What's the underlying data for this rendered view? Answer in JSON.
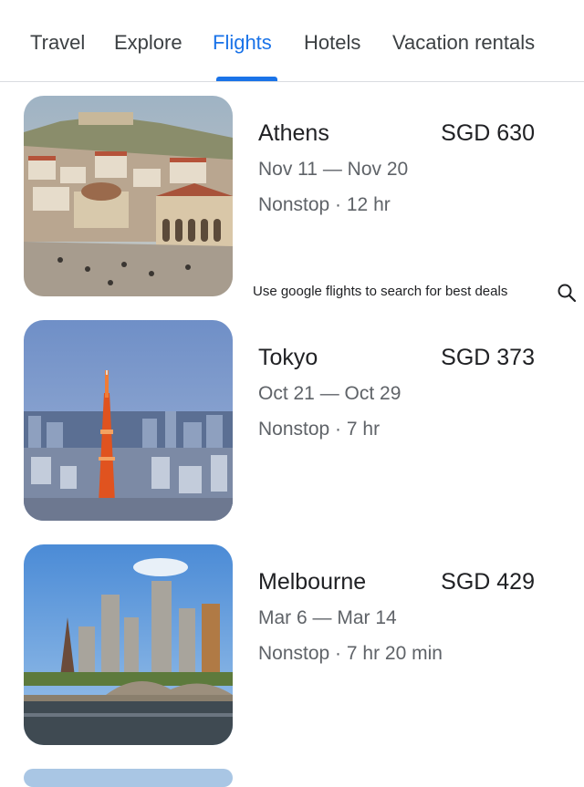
{
  "tabs": [
    {
      "label": "Travel"
    },
    {
      "label": "Explore"
    },
    {
      "label": "Flights"
    },
    {
      "label": "Hotels"
    },
    {
      "label": "Vacation rentals"
    }
  ],
  "active_tab": "Flights",
  "destinations": [
    {
      "city": "Athens",
      "price": "SGD 630",
      "dates": "Nov 11 — Nov 20",
      "stops": "Nonstop · 12 hr"
    },
    {
      "city": "Tokyo",
      "price": "SGD 373",
      "dates": "Oct 21 — Oct 29",
      "stops": "Nonstop · 7 hr"
    },
    {
      "city": "Melbourne",
      "price": "SGD 429",
      "dates": "Mar 6 — Mar 14",
      "stops": "Nonstop · 7 hr 20 min"
    }
  ],
  "sponsored": {
    "text": "Use google flights to search for best deals",
    "icon": "search-icon"
  },
  "colors": {
    "accent": "#1a73e8",
    "secondary_text": "#5f6368"
  }
}
